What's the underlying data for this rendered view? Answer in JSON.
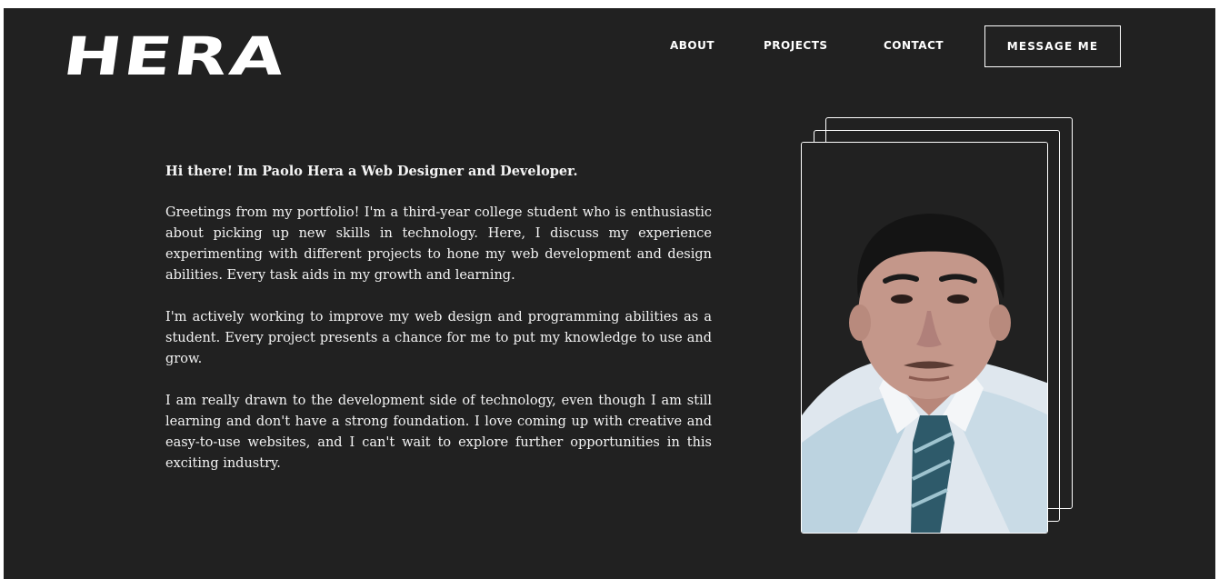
{
  "header": {
    "logo": "HERA",
    "nav": [
      {
        "label": "ABOUT"
      },
      {
        "label": "PROJECTS"
      },
      {
        "label": "CONTACT"
      }
    ],
    "message_button": "MESSAGE ME"
  },
  "about": {
    "greeting": "Hi there! Im Paolo Hera a Web Designer and Developer.",
    "paragraphs": [
      "Greetings from my portfolio! I'm a third-year college student who is enthusiastic about picking up new skills in technology. Here, I discuss my experience experimenting with different projects to hone my web development and design abilities. Every task aids in my growth and learning.",
      "I'm actively working to improve my web design and programming abilities as a student. Every project presents a chance for me to put my knowledge to use and grow.",
      "I am really drawn to the development side of technology, even though I am still learning and don't have a strong foundation. I love coming up with creative and easy-to-use websites, and I can't wait to explore further opportunities in this exciting industry."
    ]
  },
  "colors": {
    "background": "#212121",
    "text": "#ffffff",
    "page_border": "#ffffff"
  }
}
